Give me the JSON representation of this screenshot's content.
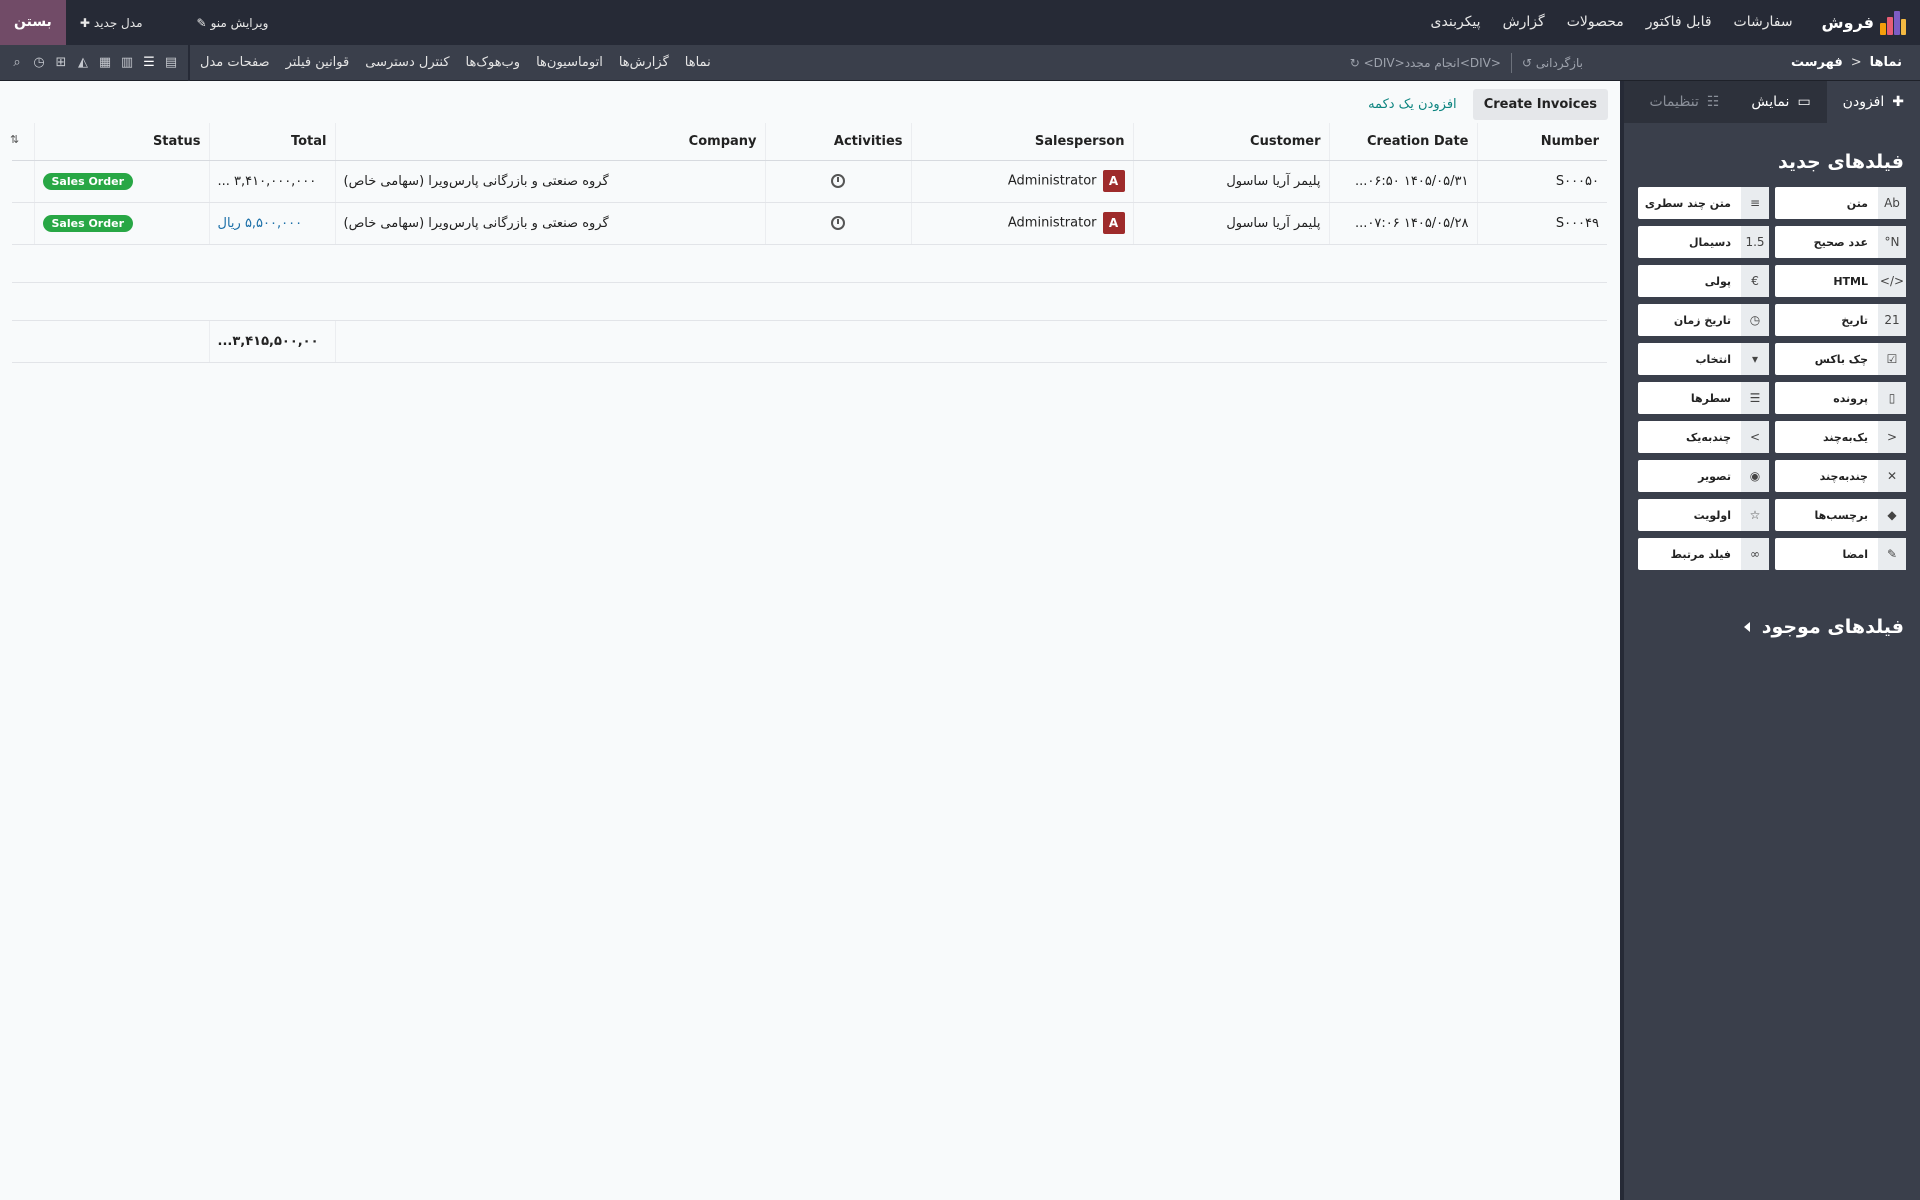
{
  "topbar": {
    "app_name": "فروش",
    "menu": [
      "سفارشات",
      "قابل فاکتور",
      "محصولات",
      "گزارش",
      "پیکربندی"
    ],
    "edit_menu": "ویرایش منو",
    "new_model": "مدل جدید",
    "close": "بستن"
  },
  "subbar": {
    "breadcrumb_root": "نماها",
    "breadcrumb_sep": ">",
    "breadcrumb_current": "فهرست",
    "restore": "بازگردانی",
    "redo": "<DIV>انجام مجدد<DIV>",
    "tabs": [
      "نماها",
      "گزارش‌ها",
      "اتوماسیون‌ها",
      "وب‌هوک‌ها",
      "کنترل دسترسی",
      "قوانین فیلتر",
      "صفحات مدل"
    ]
  },
  "sidebar": {
    "tabs": {
      "add": "افزودن",
      "view": "نمایش",
      "settings": "تنظیمات"
    },
    "new_fields_title": "فیلدهای جدید",
    "existing_fields_title": "فیلدهای موجود",
    "fields": [
      {
        "label": "متن",
        "icon": "Ab",
        "name": "text"
      },
      {
        "label": "متن چند سطری",
        "icon": "≡",
        "name": "multiline-text"
      },
      {
        "label": "عدد صحیح",
        "icon": "N°",
        "name": "integer"
      },
      {
        "label": "دسیمال",
        "icon": "1.5",
        "name": "decimal"
      },
      {
        "label": "HTML",
        "icon": "</>",
        "name": "html"
      },
      {
        "label": "پولی",
        "icon": "€",
        "name": "monetary"
      },
      {
        "label": "تاریخ",
        "icon": "21",
        "name": "date"
      },
      {
        "label": "تاریخ زمان",
        "icon": "◷",
        "name": "datetime"
      },
      {
        "label": "چک باکس",
        "icon": "☑",
        "name": "checkbox"
      },
      {
        "label": "انتخاب",
        "icon": "▾",
        "name": "selection"
      },
      {
        "label": "پرونده",
        "icon": "▯",
        "name": "file"
      },
      {
        "label": "سطرها",
        "icon": "☰",
        "name": "lines"
      },
      {
        "label": "یک‌به‌چند",
        "icon": "<",
        "name": "one2many"
      },
      {
        "label": "چندبه‌یک",
        "icon": ">",
        "name": "many2one"
      },
      {
        "label": "چندبه‌چند",
        "icon": "✕",
        "name": "many2many"
      },
      {
        "label": "تصویر",
        "icon": "◉",
        "name": "image"
      },
      {
        "label": "برچسب‌ها",
        "icon": "◆",
        "name": "tags"
      },
      {
        "label": "اولویت",
        "icon": "☆",
        "name": "priority"
      },
      {
        "label": "امضا",
        "icon": "✎",
        "name": "signature"
      },
      {
        "label": "فیلد مرتبط",
        "icon": "∞",
        "name": "related-field"
      }
    ]
  },
  "main": {
    "add_button_link": "افزودن یک دکمه",
    "create_invoices": "Create Invoices",
    "columns": {
      "number": "Number",
      "creation_date": "Creation Date",
      "customer": "Customer",
      "salesperson": "Salesperson",
      "activities": "Activities",
      "company": "Company",
      "total": "Total",
      "status": "Status"
    },
    "rows": [
      {
        "number": "S۰۰۰۵۰",
        "creation_date": "۱۴۰۵/۰۵/۳۱ ۰۶:۵۰...",
        "customer": "پلیمر آریا ساسول",
        "salesperson": "Administrator",
        "avatar": "A",
        "company": "گروه صنعتی و بازرگانی پارس‌ویرا (سهامی خاص)",
        "total": "۳,۴۱۰,۰۰۰,۰۰۰ ...",
        "status": "Sales Order"
      },
      {
        "number": "S۰۰۰۴۹",
        "creation_date": "۱۴۰۵/۰۵/۲۸ ۰۷:۰۶...",
        "customer": "پلیمر آریا ساسول",
        "salesperson": "Administrator",
        "avatar": "A",
        "company": "گروه صنعتی و بازرگانی پارس‌ویرا (سهامی خاص)",
        "total": "۵,۵۰۰,۰۰۰ ریال",
        "status": "Sales Order"
      }
    ],
    "grand_total": "۳,۴۱۵,۵۰۰,۰۰..."
  },
  "colors": {
    "topbar": "#262a36",
    "subbar": "#3a3f4b",
    "accent": "#714b67",
    "badge": "#28a745",
    "avatar": "#9e2b2b",
    "link": "#0e8580"
  }
}
